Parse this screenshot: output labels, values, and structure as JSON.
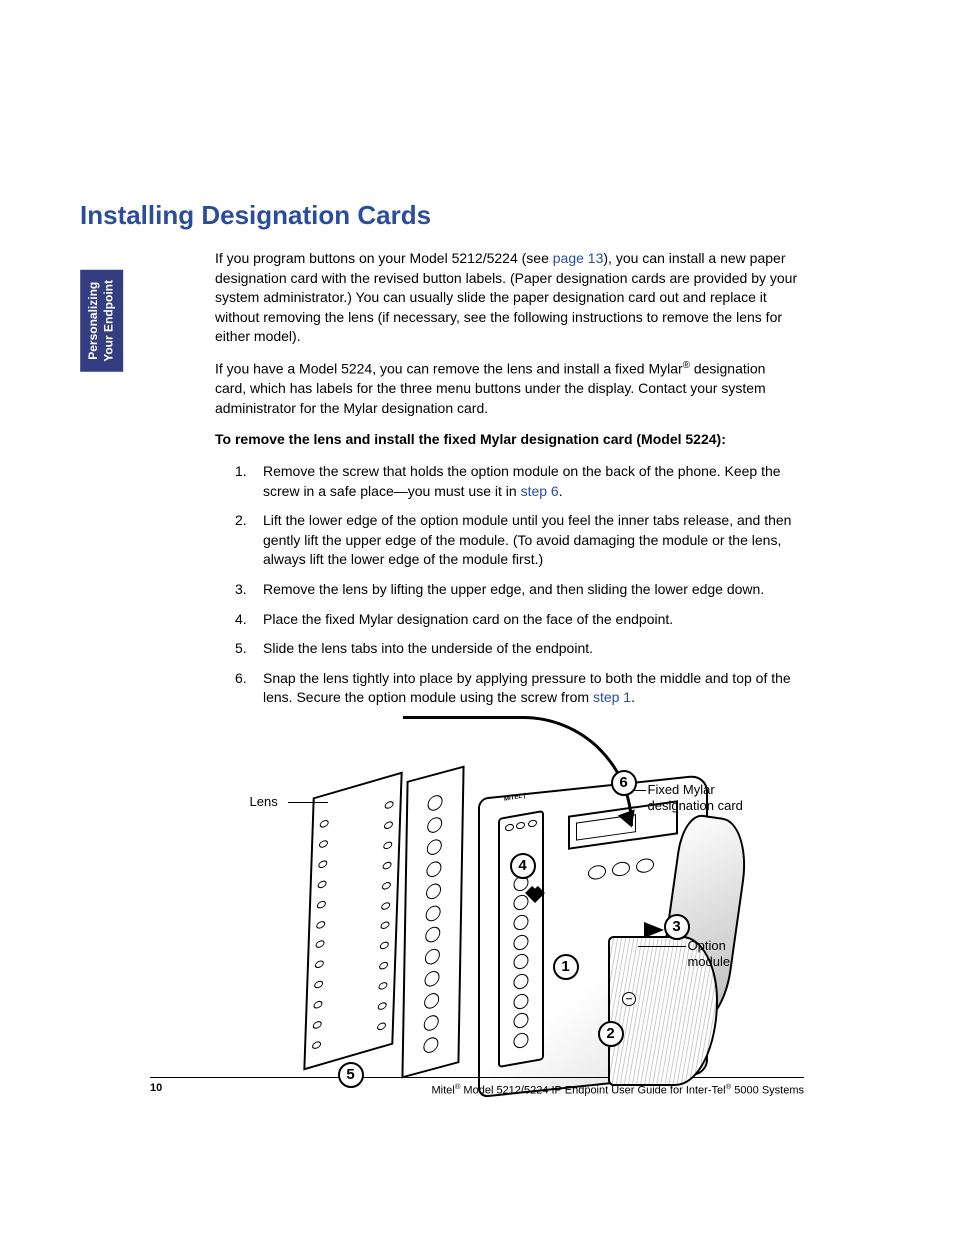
{
  "sideTab": {
    "line1": "Personalizing",
    "line2": "Your Endpoint"
  },
  "heading": "Installing Designation Cards",
  "para1": {
    "t1": "If you program buttons on your Model 5212/5224 (see ",
    "link": "page 13",
    "t2": "), you can install a new paper designation card with the revised button labels. (Paper designation cards are provided by your system administrator.) You can usually slide the paper designation card out and replace it without removing the lens (if necessary, see the following instructions to remove the lens for either model)."
  },
  "para2": {
    "t1": "If you have a Model 5224, you can remove the lens and install a fixed Mylar",
    "sup": "®",
    "t2": " designation card, which has labels for the three menu buttons under the display. Contact your system administrator for the Mylar designation card."
  },
  "boldIntro": "To remove the lens and install the fixed Mylar designation card (Model 5224):",
  "steps": [
    {
      "t1": "Remove the screw that holds the option module on the back of the phone. Keep the screw in a safe place—you must use it in ",
      "link": "step 6",
      "t2": "."
    },
    {
      "t1": "Lift the lower edge of the option module until you feel the inner tabs release, and then gently lift the upper edge of the module. (To avoid damaging the module or the lens, always lift the lower edge of the module first.)",
      "link": "",
      "t2": ""
    },
    {
      "t1": "Remove the lens by lifting the upper edge, and then sliding the lower edge down.",
      "link": "",
      "t2": ""
    },
    {
      "t1": "Place the fixed Mylar designation card on the face of the endpoint.",
      "link": "",
      "t2": ""
    },
    {
      "t1": "Slide the lens tabs into the underside of the endpoint.",
      "link": "",
      "t2": ""
    },
    {
      "t1": "Snap the lens tightly into place by applying pressure to both the middle and top of the lens. Secure the option module using the screw from ",
      "link": "step 1",
      "t2": "."
    }
  ],
  "figure": {
    "lensLabel": "Lens",
    "mylarLabel": "Fixed Mylar designation card",
    "optionLabel": "Option module",
    "bubbles": {
      "b1": "1",
      "b2": "2",
      "b3": "3",
      "b4": "4",
      "b5": "5",
      "b6": "6"
    },
    "badge": "MITEL |"
  },
  "footer": {
    "page": "10",
    "t1": "Mitel",
    "sup1": "®",
    "t2": " Model 5212/5224 IP Endpoint User Guide for Inter-Tel",
    "sup2": "®",
    "t3": " 5000 Systems"
  }
}
